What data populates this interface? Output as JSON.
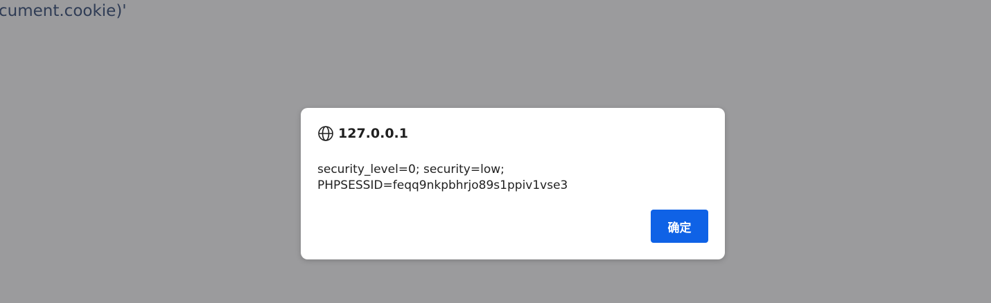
{
  "background": {
    "overlay_color": "#9b9b9d",
    "visible_text": "cument.cookie)'"
  },
  "dialog": {
    "origin": "127.0.0.1",
    "icon": "globe-icon",
    "message_lines": [
      "security_level=0; security=low;",
      "PHPSESSID=feqq9nkpbhrjo89s1ppiv1vse3"
    ],
    "ok_label": "确定",
    "accent_color": "#0f62e6"
  }
}
